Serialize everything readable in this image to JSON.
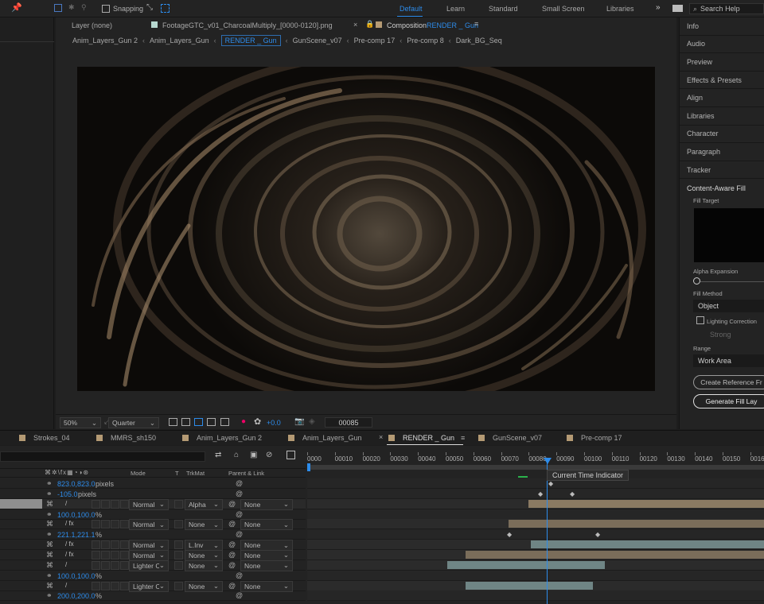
{
  "topbar": {
    "snapping_label": "Snapping",
    "workspaces": [
      "Default",
      "Learn",
      "Standard",
      "Small Screen",
      "Libraries"
    ],
    "active_workspace": "Default",
    "search_placeholder": "Search Help"
  },
  "viewer_tabs": {
    "layer": "Layer (none)",
    "footage_prefix": "Footage",
    "footage_name": "GTC_v01_CharcoalMultiply_[0000-0120].png",
    "composition_prefix": "Composition",
    "composition_name": "RENDER _ Gun"
  },
  "flowchart": [
    "Anim_Layers_Gun 2",
    "Anim_Layers_Gun",
    "RENDER _ Gun",
    "GunScene_v07",
    "Pre-comp 17",
    "Pre-comp 8",
    "Dark_BG_Seq"
  ],
  "viewer_footer": {
    "zoom": "50%",
    "resolution": "Quarter",
    "exposure": "+0.0",
    "timecode": "00085"
  },
  "right_panel": {
    "items": [
      "Info",
      "Audio",
      "Preview",
      "Effects & Presets",
      "Align",
      "Libraries",
      "Character",
      "Paragraph",
      "Tracker"
    ],
    "caf": {
      "title": "Content-Aware Fill",
      "fill_target": "Fill Target",
      "alpha_expansion": "Alpha Expansion",
      "fill_method": "Fill Method",
      "fill_method_value": "Object",
      "lighting_correction": "Lighting Correction",
      "strength": "Strong",
      "range": "Range",
      "range_value": "Work Area",
      "create_reference": "Create Reference Fr",
      "generate": "Generate Fill Lay"
    }
  },
  "timeline_tabs": [
    {
      "name": "Strokes_04",
      "color": "#9b8b6a"
    },
    {
      "name": "MMRS_sh150",
      "color": "#9b8b6a"
    },
    {
      "name": "Anim_Layers_Gun 2",
      "color": "#9b8b6a"
    },
    {
      "name": "Anim_Layers_Gun",
      "color": "#9b8b6a"
    },
    {
      "name": "RENDER _ Gun",
      "color": "#9b8b6a"
    },
    {
      "name": "GunScene_v07",
      "color": "#9b8b6a"
    },
    {
      "name": "Pre-comp 17",
      "color": "#9b8b6a"
    }
  ],
  "columns": {
    "mode": "Mode",
    "t": "T",
    "trkmat": "TrkMat",
    "parent": "Parent & Link"
  },
  "ruler_ticks": [
    "0000",
    "00010",
    "00020",
    "00030",
    "00040",
    "00050",
    "00060",
    "00070",
    "00080",
    "00090",
    "00100",
    "00110",
    "00120",
    "00130",
    "00140",
    "00150",
    "00160"
  ],
  "tooltip": "Current Time Indicator",
  "layers": [
    {
      "kind": "prop",
      "value": "823.0,823.0",
      "unit": " pixels"
    },
    {
      "kind": "prop",
      "value": "-105.0",
      "unit": " pixels"
    },
    {
      "kind": "layer",
      "mode": "Normal",
      "trkmat": "Alpha",
      "parent": "None",
      "selected": true
    },
    {
      "kind": "prop",
      "value": "100.0,100.0",
      "unit": "%"
    },
    {
      "kind": "layer",
      "mode": "Normal",
      "trkmat": "None",
      "parent": "None",
      "fx": true
    },
    {
      "kind": "prop",
      "value": "221.1,221.1",
      "unit": "%"
    },
    {
      "kind": "layer",
      "mode": "Normal",
      "trkmat": "L.Inv",
      "parent": "None",
      "fx": true
    },
    {
      "kind": "layer",
      "mode": "Normal",
      "trkmat": "None",
      "parent": "None",
      "fx": true
    },
    {
      "kind": "layer",
      "mode": "Lighter Co",
      "trkmat": "None",
      "parent": "None"
    },
    {
      "kind": "prop",
      "value": "100.0,100.0",
      "unit": "%"
    },
    {
      "kind": "layer",
      "mode": "Lighter Co",
      "trkmat": "None",
      "parent": "None"
    },
    {
      "kind": "prop",
      "value": "200.0,200.0",
      "unit": "%"
    }
  ],
  "colors": {
    "accent": "#2d8ceb",
    "bar_tan": "#8a7a62",
    "bar_teal": "#6f8585"
  },
  "current_frame": 85
}
